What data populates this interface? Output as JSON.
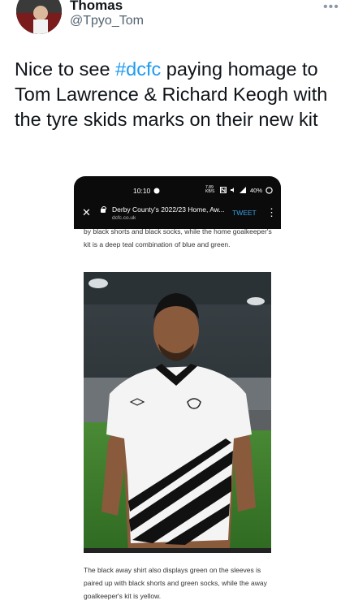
{
  "tweet": {
    "author_name": "Thomas",
    "author_handle": "@Tpyo_Tom",
    "text_prefix": "Nice to see ",
    "hashtag": "#dcfc",
    "text_suffix": " paying homage to Tom Lawrence & Richard Keogh with the tyre skids marks on their new kit"
  },
  "embedded_screenshot": {
    "status_bar": {
      "time": "10:10",
      "indicators": "7.89 KB/S",
      "battery": "40%"
    },
    "browser": {
      "page_title": "Derby County's 2022/23 Home, Aw...",
      "domain": "dcfc.co.uk",
      "tweet_button": "TWEET"
    },
    "article_text_top": "by black shorts and black socks, while the home goalkeeper's kit is a deep teal combination of blue and green.",
    "article_text_bottom": "The black away shirt also displays green on the sleeves is paired up with black shorts and green socks, while the away goalkeeper's kit is yellow."
  },
  "colors": {
    "hashtag": "#1d9bf0",
    "handle": "#536471",
    "browser_bar": "#0b0b0b",
    "pitch_green": "#3f7d2e"
  }
}
